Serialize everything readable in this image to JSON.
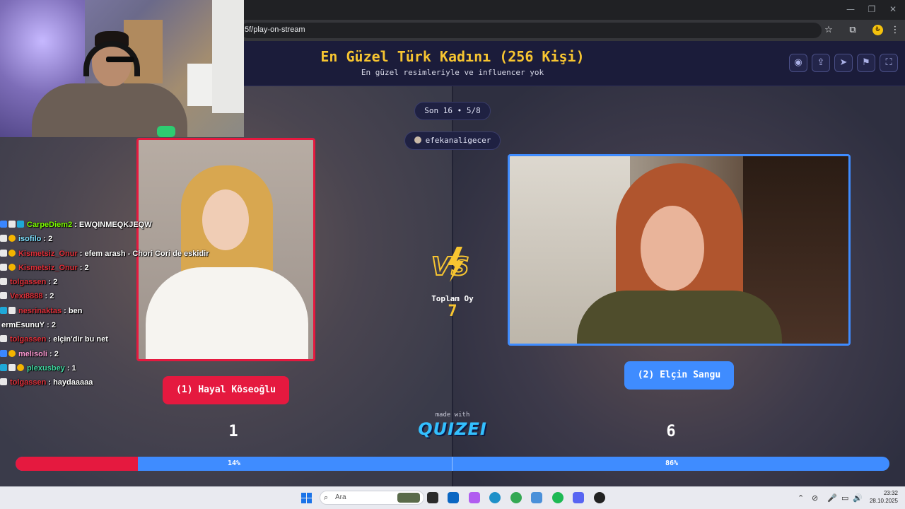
{
  "browser": {
    "url_fragment": "5f/play-on-stream",
    "min_icon": "—",
    "max_icon": "❐",
    "star_icon": "☆",
    "ext_icon": "⧉",
    "coin_icon": "₺",
    "menu_icon": "⋮"
  },
  "quiz": {
    "title": "En Güzel Türk Kadını (256 Kişi)",
    "subtitle": "En güzel resimleriyle ve influencer yok",
    "round": "Son 16 • 5/8",
    "user": "efekanaligecer",
    "vs_text": "VS",
    "total_votes_label": "Toplam Oy",
    "total_votes": "7",
    "made_with": "made with",
    "brand": "QUIZEI",
    "header_icons": [
      "eye-icon",
      "share-icon",
      "send-icon",
      "flag-icon",
      "fullscreen-icon"
    ],
    "header_glyphs": [
      "◉",
      "⇪",
      "➤",
      "⚑",
      "⛶"
    ]
  },
  "left": {
    "name": "(1) Hayal Köseoğlu",
    "votes": "1",
    "percent_text": "14%",
    "percent": 14,
    "color": "#e5193f"
  },
  "right": {
    "name": "(2) Elçin Sangu",
    "votes": "6",
    "percent_text": "86%",
    "percent": 86,
    "color": "#3f8cff"
  },
  "chat": [
    {
      "badges": [
        "b",
        "w",
        "c"
      ],
      "user": "CarpeDiem2",
      "color": "#7CFC00",
      "msg": ": EWQINMEQKJEQW"
    },
    {
      "badges": [
        "w",
        "o"
      ],
      "user": "isofilo",
      "color": "#7ee0ff",
      "msg": ": 2"
    },
    {
      "badges": [
        "w",
        "o"
      ],
      "user": "Kismetsiz_Onur",
      "color": "#e0303a",
      "msg": ": efem arash - Chori Cori de eskidir"
    },
    {
      "badges": [
        "w",
        "o"
      ],
      "user": "Kismetsiz_Onur",
      "color": "#e0303a",
      "msg": ": 2"
    },
    {
      "badges": [
        "w"
      ],
      "user": "tolgassen",
      "color": "#e0303a",
      "msg": ": 2"
    },
    {
      "badges": [
        "w"
      ],
      "user": "Vexi8888",
      "color": "#e0303a",
      "msg": ": 2"
    },
    {
      "badges": [
        "c",
        "w"
      ],
      "user": "nesrinaktas",
      "color": "#e0303a",
      "msg": ": ben"
    },
    {
      "badges": [],
      "user": "ermEsunuY",
      "color": "#ffffff",
      "msg": ": 2"
    },
    {
      "badges": [
        "w"
      ],
      "user": "tolgassen",
      "color": "#e0303a",
      "msg": ": elçin'dir bu net"
    },
    {
      "badges": [
        "b",
        "o"
      ],
      "user": "melisoli",
      "color": "#ff9ad5",
      "msg": ": 2"
    },
    {
      "badges": [
        "c",
        "w",
        "o"
      ],
      "user": "plexusbey",
      "color": "#3fd8a0",
      "msg": ": 1"
    },
    {
      "badges": [
        "w"
      ],
      "user": "tolgassen",
      "color": "#e0303a",
      "msg": ": haydaaaaa"
    }
  ],
  "taskbar": {
    "search_placeholder": "Ara",
    "time": "23:32",
    "date": "28.10.2025",
    "tray_chevron": "⌃",
    "tray_mic": "🎤",
    "tray_speaker": "🔊"
  }
}
